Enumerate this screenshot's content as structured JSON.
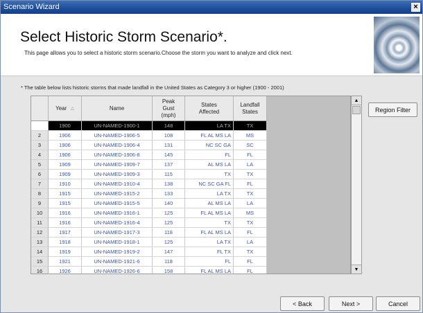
{
  "window": {
    "title": "Scenario Wizard",
    "close_label": "×"
  },
  "header": {
    "title": "Select Historic Storm Scenario*.",
    "subtitle": "This page allows you to select a historic storm scenario.Choose the storm you want to analyze and click next."
  },
  "note": "* The table below lists historic storms that made landfall in the United States as Category 3 or higher (1900 - 2001)",
  "table": {
    "columns": {
      "year": "Year",
      "sort_indicator": "△",
      "name": "Name",
      "peak_gust": "Peak Gust (mph)",
      "states_affected": "States Affected",
      "landfall_states": "Landfall States"
    },
    "rows": [
      {
        "num": "",
        "year": "1900",
        "name": "UN-NAMED-1900-1",
        "gust": "148",
        "affected": "LA TX",
        "landfall": "TX",
        "selected": true
      },
      {
        "num": "2",
        "year": "1906",
        "name": "UN-NAMED-1906-5",
        "gust": "108",
        "affected": "FL AL MS LA",
        "landfall": "MS"
      },
      {
        "num": "3",
        "year": "1906",
        "name": "UN-NAMED-1906-4",
        "gust": "131",
        "affected": "NC SC GA",
        "landfall": "SC"
      },
      {
        "num": "4",
        "year": "1906",
        "name": "UN-NAMED-1906-8",
        "gust": "145",
        "affected": "FL",
        "landfall": "FL"
      },
      {
        "num": "5",
        "year": "1909",
        "name": "UN-NAMED-1909-7",
        "gust": "137",
        "affected": "AL MS LA",
        "landfall": "LA"
      },
      {
        "num": "6",
        "year": "1909",
        "name": "UN-NAMED-1909-3",
        "gust": "115",
        "affected": "TX",
        "landfall": "TX"
      },
      {
        "num": "7",
        "year": "1910",
        "name": "UN-NAMED-1910-4",
        "gust": "138",
        "affected": "NC SC GA FL",
        "landfall": "FL"
      },
      {
        "num": "8",
        "year": "1915",
        "name": "UN-NAMED-1915-2",
        "gust": "133",
        "affected": "LA TX",
        "landfall": "TX"
      },
      {
        "num": "9",
        "year": "1915",
        "name": "UN-NAMED-1915-5",
        "gust": "140",
        "affected": "AL MS LA",
        "landfall": "LA"
      },
      {
        "num": "10",
        "year": "1916",
        "name": "UN-NAMED-1916-1",
        "gust": "125",
        "affected": "FL AL MS LA",
        "landfall": "MS"
      },
      {
        "num": "11",
        "year": "1916",
        "name": "UN-NAMED-1916-4",
        "gust": "125",
        "affected": "TX",
        "landfall": "TX"
      },
      {
        "num": "12",
        "year": "1917",
        "name": "UN-NAMED-1917-3",
        "gust": "118",
        "affected": "FL AL MS LA",
        "landfall": "FL"
      },
      {
        "num": "13",
        "year": "1918",
        "name": "UN-NAMED-1918-1",
        "gust": "125",
        "affected": "LA TX",
        "landfall": "LA"
      },
      {
        "num": "14",
        "year": "1919",
        "name": "UN-NAMED-1919-2",
        "gust": "147",
        "affected": "FL TX",
        "landfall": "TX"
      },
      {
        "num": "15",
        "year": "1921",
        "name": "UN-NAMED-1921-6",
        "gust": "118",
        "affected": "FL",
        "landfall": "FL"
      },
      {
        "num": "16",
        "year": "1926",
        "name": "UN-NAMED-1926-6",
        "gust": "158",
        "affected": "FL AL MS LA",
        "landfall": "FL"
      }
    ]
  },
  "scrollbar": {
    "up_glyph": "▲",
    "down_glyph": "▼"
  },
  "buttons": {
    "region_filter": "Region Filter",
    "back": "< Back",
    "next": "Next >",
    "cancel": "Cancel"
  },
  "icons": {
    "storm_image": "hurricane-satellite-image",
    "close": "close-icon"
  }
}
